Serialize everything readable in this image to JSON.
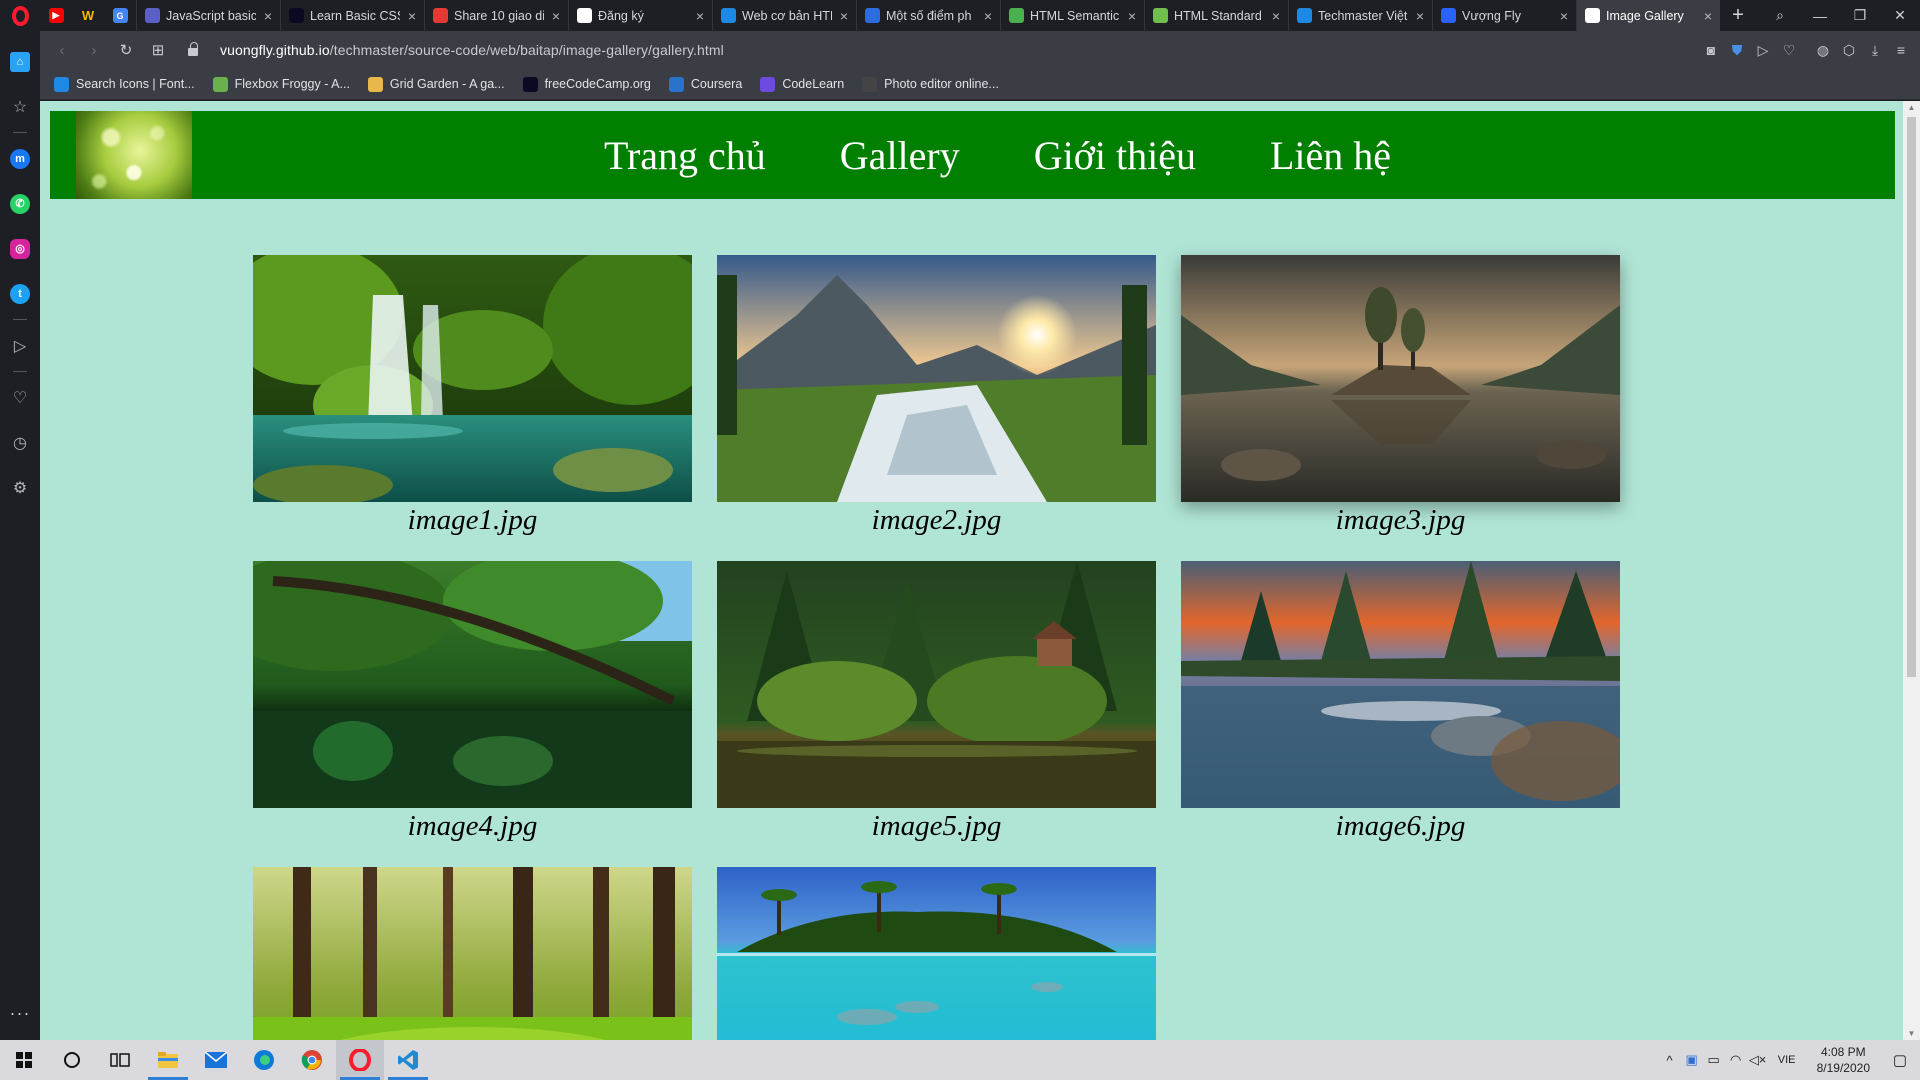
{
  "browser": {
    "tabs": [
      {
        "title": "JavaScript basic",
        "favicon_color": "#5b5fc7",
        "active": false
      },
      {
        "title": "Learn Basic CSS",
        "favicon_color": "#0a0a23",
        "active": false
      },
      {
        "title": "Share 10 giao di",
        "favicon_color": "#e53935",
        "active": false
      },
      {
        "title": "Đăng ký",
        "favicon_color": "#ffffff",
        "active": false
      },
      {
        "title": "Web cơ bản HTI",
        "favicon_color": "#1e88e5",
        "active": false
      },
      {
        "title": "Một số điểm ph",
        "favicon_color": "#2d6cdf",
        "active": false
      },
      {
        "title": "HTML Semantic",
        "favicon_color": "#4caf50",
        "active": false
      },
      {
        "title": "HTML Standard",
        "favicon_color": "#6fbf4a",
        "active": false
      },
      {
        "title": "Techmaster Việt",
        "favicon_color": "#1e88e5",
        "active": false
      },
      {
        "title": "Vượng Fly",
        "favicon_color": "#2962ff",
        "active": false
      },
      {
        "title": "Image Gallery",
        "favicon_color": "#ffffff",
        "active": true
      }
    ],
    "url_host": "vuongfly.github.io",
    "url_prefix": "",
    "url_path": "/techmaster/source-code/web/baitap/image-gallery/gallery.html",
    "bookmarks": [
      {
        "label": "Search Icons | Font...",
        "color": "#1e88e5"
      },
      {
        "label": "Flexbox Froggy - A...",
        "color": "#6ab04c"
      },
      {
        "label": "Grid Garden - A ga...",
        "color": "#e8b84a"
      },
      {
        "label": "freeCodeCamp.org",
        "color": "#0a0a23"
      },
      {
        "label": "Coursera",
        "color": "#2a73cc"
      },
      {
        "label": "CodeLearn",
        "color": "#6c4ce0"
      },
      {
        "label": "Photo editor online...",
        "color": "#444444"
      }
    ]
  },
  "site": {
    "nav": [
      "Trang chủ",
      "Gallery",
      "Giới thiệu",
      "Liên hệ"
    ],
    "gallery": [
      {
        "caption": "image1.jpg",
        "theme": "waterfall"
      },
      {
        "caption": "image2.jpg",
        "theme": "sunset-falls"
      },
      {
        "caption": "image3.jpg",
        "theme": "lake-tree"
      },
      {
        "caption": "image4.jpg",
        "theme": "jungle-river"
      },
      {
        "caption": "image5.jpg",
        "theme": "forest-house"
      },
      {
        "caption": "image6.jpg",
        "theme": "sunset-lake"
      },
      {
        "caption": "",
        "theme": "sunlit-forest"
      },
      {
        "caption": "",
        "theme": "tropical-island"
      }
    ]
  },
  "taskbar": {
    "language": "VIE",
    "time": "4:08 PM",
    "date": "8/19/2020"
  }
}
